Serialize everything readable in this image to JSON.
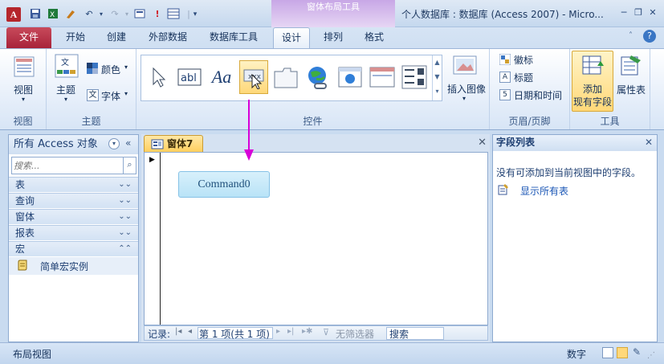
{
  "window": {
    "app_icon": "A",
    "title": "个人数据库 : 数据库 (Access 2007)  -  Micro...",
    "context_tab_group": "窗体布局工具",
    "controls": {
      "minimize": "─",
      "restore": "❐",
      "close": "✕"
    }
  },
  "qat": {
    "save_icon": "save-icon",
    "excel_icon": "excel-icon",
    "undo": "↶",
    "redo": "↷"
  },
  "tabs": [
    {
      "label": "文件"
    },
    {
      "label": "开始"
    },
    {
      "label": "创建"
    },
    {
      "label": "外部数据"
    },
    {
      "label": "数据库工具"
    },
    {
      "label": "设计"
    },
    {
      "label": "排列"
    },
    {
      "label": "格式"
    }
  ],
  "ribbon": {
    "groups": {
      "view": {
        "label": "视图",
        "button": "视图"
      },
      "theme": {
        "label": "主题",
        "theme_button": "主题",
        "colors": "颜色",
        "fonts": "字体"
      },
      "controls": {
        "label": "控件",
        "insert_image": "插入图像"
      },
      "header_footer": {
        "label": "页眉/页脚",
        "logo": "徽标",
        "title": "标题",
        "datetime": "日期和时间"
      },
      "tools": {
        "label": "工具",
        "add_fields": "添加\n现有字段",
        "add_fields_l1": "添加",
        "add_fields_l2": "现有字段",
        "property_sheet": "属性表"
      }
    }
  },
  "nav_pane": {
    "title": "所有 Access 对象",
    "search_placeholder": "搜索...",
    "categories": [
      {
        "label": "表"
      },
      {
        "label": "查询"
      },
      {
        "label": "窗体"
      },
      {
        "label": "报表"
      },
      {
        "label": "宏"
      }
    ],
    "macro_item": "简单宏实例"
  },
  "document": {
    "tab_label": "窗体7",
    "command_button": "Command0",
    "record_nav": {
      "prefix": "记录:",
      "position": "第 1 项(共 1 项)",
      "filter": "无筛选器",
      "search": "搜索"
    }
  },
  "field_list": {
    "title": "字段列表",
    "message": "没有可添加到当前视图中的字段。",
    "show_all": "显示所有表"
  },
  "statusbar": {
    "left": "布局视图",
    "mode": "数字"
  },
  "colors": {
    "accent_purple": "#d800d8",
    "file_tab": "#b52d42",
    "selected_gallery": "#ffd87a"
  }
}
